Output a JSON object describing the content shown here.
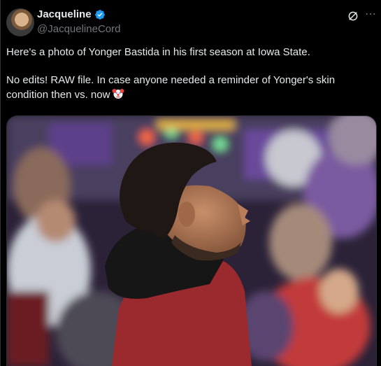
{
  "author": {
    "name": "Jacqueline",
    "handle": "@JacquelineCord",
    "verified": true
  },
  "post": {
    "line1": "Here's a photo of Yonger Bastida in his first season at Iowa State.",
    "line2": "No edits! RAW file. In case anyone needed a reminder of Yonger's skin condition then vs. now",
    "emoji": "clown-face"
  },
  "icons": {
    "verified": "verified-badge-icon",
    "grok": "grok-icon",
    "more": "more-options-icon"
  },
  "colors": {
    "background": "#000000",
    "text": "#e7e9ea",
    "secondary": "#71767b",
    "verified": "#1d9bf0"
  }
}
